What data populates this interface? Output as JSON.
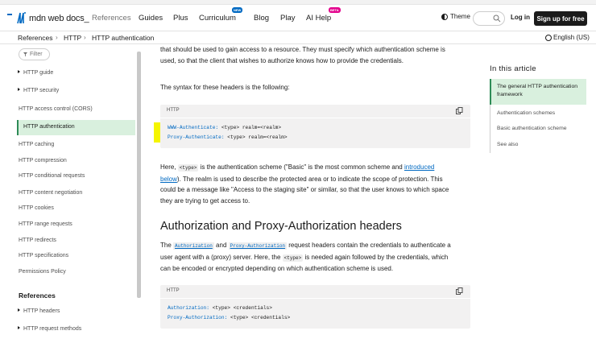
{
  "header": {
    "logo_text": "mdn web docs_",
    "nav": [
      {
        "label": "References",
        "muted": true
      },
      {
        "label": "Guides"
      },
      {
        "label": "Plus"
      },
      {
        "label": "Curriculum",
        "badge": "NEW"
      },
      {
        "label": "Blog"
      },
      {
        "label": "Play"
      },
      {
        "label": "AI Help",
        "badge": "BETA"
      }
    ],
    "theme_label": "Theme",
    "login_label": "Log in",
    "signup_label": "Sign up for free"
  },
  "breadcrumb": [
    "References",
    "HTTP",
    "HTTP authentication"
  ],
  "language": "English (US)",
  "sidebar": {
    "filter_placeholder": "Filter",
    "items": [
      {
        "label": "HTTP guide",
        "group": true
      },
      {
        "label": "HTTP security",
        "group": true
      },
      {
        "label": "HTTP access control (CORS)"
      },
      {
        "label": "HTTP authentication",
        "active": true
      },
      {
        "label": "HTTP caching"
      },
      {
        "label": "HTTP compression"
      },
      {
        "label": "HTTP conditional requests"
      },
      {
        "label": "HTTP content negotiation"
      },
      {
        "label": "HTTP cookies"
      },
      {
        "label": "HTTP range requests"
      },
      {
        "label": "HTTP redirects"
      },
      {
        "label": "HTTP specifications"
      },
      {
        "label": "Permissions Policy"
      }
    ],
    "references_heading": "References",
    "reference_items": [
      {
        "label": "HTTP headers"
      },
      {
        "label": "HTTP request methods"
      }
    ]
  },
  "content": {
    "p1_line1": "that should be used to gain access to a resource. They must specify which authentication scheme is",
    "p1_line2": "used, so that the client that wishes to authorize knows how to provide the credentials.",
    "p2": "The syntax for these headers is the following:",
    "code1": {
      "lang": "HTTP",
      "lines": [
        {
          "key": "WWW-Authenticate:",
          "rest": " <type> realm=<realm>"
        },
        {
          "key": "Proxy-Authenticate:",
          "rest": " <type> realm=<realm>"
        }
      ]
    },
    "p3": {
      "a": "Here, ",
      "code": "<type>",
      "b": " is the authentication scheme (\"Basic\" is the most common scheme and ",
      "link1": "introduced",
      "link2": "below",
      "c": "). The realm is used to describe the protected area or to indicate the scope of protection. This",
      "line3": "could be a message like \"Access to the staging site\" or similar, so that the user knows to which space",
      "line4": "they are trying to get access to."
    },
    "h2": "Authorization and Proxy-Authorization headers",
    "p4": {
      "a": "The ",
      "code1": "Authorization",
      "b": " and ",
      "code2": "Proxy-Authorization",
      "c": " request headers contain the credentials to authenticate a",
      "line2a": "user agent with a (proxy) server. Here, the ",
      "code3": "<type>",
      "line2b": " is needed again followed by the credentials, which",
      "line3": "can be encoded or encrypted depending on which authentication scheme is used."
    },
    "code2": {
      "lang": "HTTP",
      "lines": [
        {
          "key": "Authorization:",
          "rest": " <type> <credentials>"
        },
        {
          "key": "Proxy-Authorization:",
          "rest": " <type> <credentials>"
        }
      ]
    }
  },
  "toc": {
    "title": "In this article",
    "items": [
      {
        "label": "The general HTTP authentication framework",
        "active": true
      },
      {
        "label": "Authentication schemes"
      },
      {
        "label": "Basic authentication scheme"
      },
      {
        "label": "See also"
      }
    ]
  },
  "colors": {
    "accent": "#0069c2",
    "active_bg": "#d9f0de",
    "active_border": "#2e8b57",
    "highlight": "#f5f500"
  }
}
